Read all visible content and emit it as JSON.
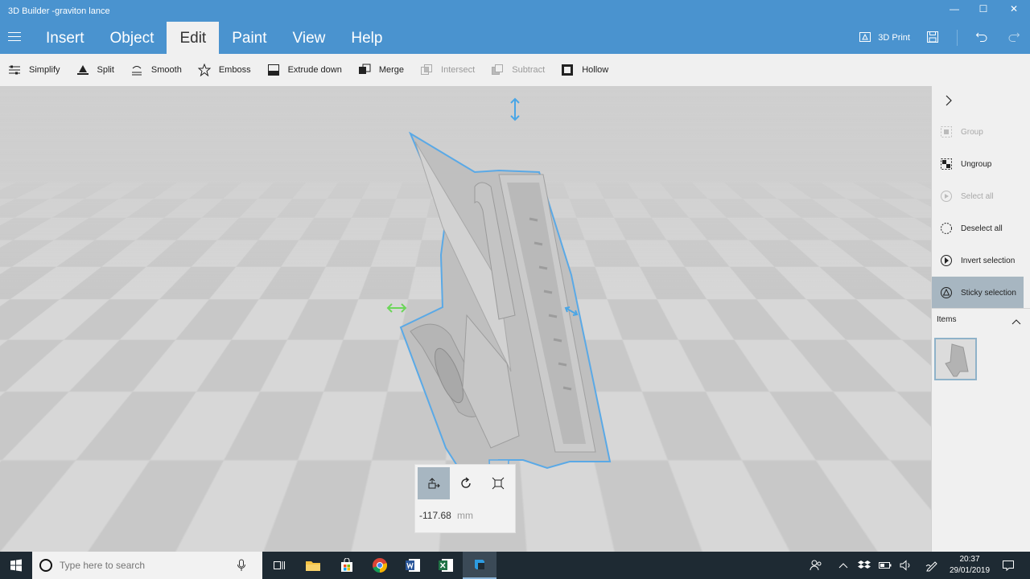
{
  "window": {
    "title": "3D Builder -graviton lance",
    "controls": {
      "minimize": "—",
      "maximize": "☐",
      "close": "✕"
    }
  },
  "menu": {
    "tabs": [
      {
        "label": "Insert"
      },
      {
        "label": "Object"
      },
      {
        "label": "Edit"
      },
      {
        "label": "Paint"
      },
      {
        "label": "View"
      },
      {
        "label": "Help"
      }
    ],
    "active_tab": "Edit",
    "right": {
      "print_label": "3D Print"
    }
  },
  "toolbar": {
    "items": [
      {
        "label": "Simplify",
        "icon": "simplify-icon",
        "enabled": true
      },
      {
        "label": "Split",
        "icon": "split-icon",
        "enabled": true
      },
      {
        "label": "Smooth",
        "icon": "smooth-icon",
        "enabled": true
      },
      {
        "label": "Emboss",
        "icon": "emboss-star-icon",
        "enabled": true
      },
      {
        "label": "Extrude down",
        "icon": "extrude-down-icon",
        "enabled": true
      },
      {
        "label": "Merge",
        "icon": "merge-icon",
        "enabled": true
      },
      {
        "label": "Intersect",
        "icon": "intersect-icon",
        "enabled": false
      },
      {
        "label": "Subtract",
        "icon": "subtract-icon",
        "enabled": false
      },
      {
        "label": "Hollow",
        "icon": "hollow-icon",
        "enabled": true
      }
    ]
  },
  "transform": {
    "value": "-117.68",
    "unit": "mm",
    "modes": [
      "move",
      "rotate",
      "scale"
    ],
    "active_mode": "move"
  },
  "right_panel": {
    "items": [
      {
        "label": "Group",
        "icon": "group-icon",
        "enabled": false
      },
      {
        "label": "Ungroup",
        "icon": "ungroup-icon",
        "enabled": true
      },
      {
        "label": "Select all",
        "icon": "select-all-icon",
        "enabled": false
      },
      {
        "label": "Deselect all",
        "icon": "deselect-all-icon",
        "enabled": true
      },
      {
        "label": "Invert selection",
        "icon": "invert-selection-icon",
        "enabled": true
      },
      {
        "label": "Sticky selection",
        "icon": "sticky-selection-icon",
        "enabled": true,
        "active": true
      }
    ],
    "items_label": "Items"
  },
  "taskbar": {
    "search_placeholder": "Type here to search",
    "time": "20:37",
    "date": "29/01/2019"
  },
  "colors": {
    "accent": "#4a93cf",
    "selection_outline": "#5aa9e6",
    "active_button": "#a7b6c1",
    "taskbar": "#1e2a33"
  }
}
